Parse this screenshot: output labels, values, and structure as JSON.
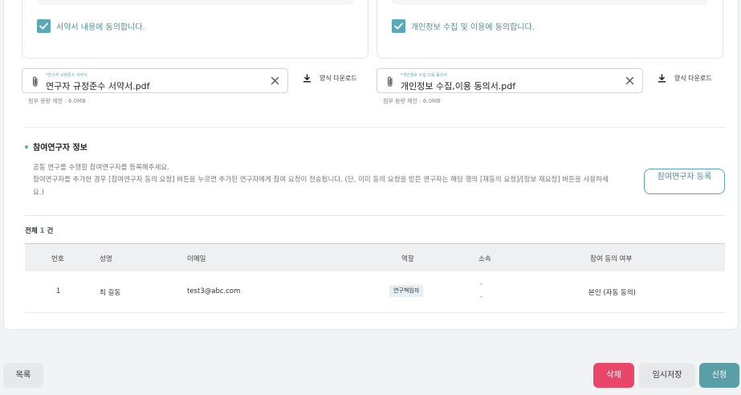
{
  "consents": [
    {
      "label": "서약서 내용에 동의합니다.",
      "checked": true
    },
    {
      "label": "개인정보 수집 및 이용에 동의합니다.",
      "checked": true
    }
  ],
  "files": [
    {
      "tiny_label": "*연구자 규정준수 서약서",
      "filename": "연구자 규정준수 서약서.pdf",
      "limit": "첨부 용량 제한 : 6.0MB",
      "download_label": "양식 다운로드"
    },
    {
      "tiny_label": "*개인정보 수집·이용 동의서",
      "filename": "개인정보 수집,이용 동의서.pdf",
      "limit": "첨부 용량 제한 : 6.0MB",
      "download_label": "양식 다운로드"
    }
  ],
  "participants": {
    "title": "참여연구자 정보",
    "desc_line1": "공동 연구를 수행할 참여연구자를 등록해주세요.",
    "desc_line2": "참여연구자를 추가한 경우 [참여연구자 동의 요청] 버튼을 누르면 추가된 연구자에게 참여 요청이 전송됩니다. (단, 이미 동의 요청을 받은 연구자는 해당 행의 [재동의 요청]/[정보 재요청] 버튼을 사용하세",
    "desc_line3": "요.)",
    "register_label": "참여연구자 등록",
    "total_prefix": "전체",
    "total_count": "1",
    "total_suffix": "건",
    "columns": [
      "번호",
      "성명",
      "이메일",
      "역할",
      "소속",
      "참여 동의 여부"
    ],
    "rows": [
      {
        "no": "1",
        "name": "최 길동",
        "email": "test3@abc.com",
        "role": "연구책임자",
        "affiliation_1": "-",
        "affiliation_2": "-",
        "consent": "본인 (자동 동의)"
      }
    ]
  },
  "footer": {
    "list_label": "목록",
    "delete_label": "삭제",
    "temp_save_label": "임시저장",
    "apply_label": "신청"
  },
  "colors": {
    "accent": "#5aa8b8",
    "delete": "#e9476a",
    "apply": "#5a9fa7"
  }
}
